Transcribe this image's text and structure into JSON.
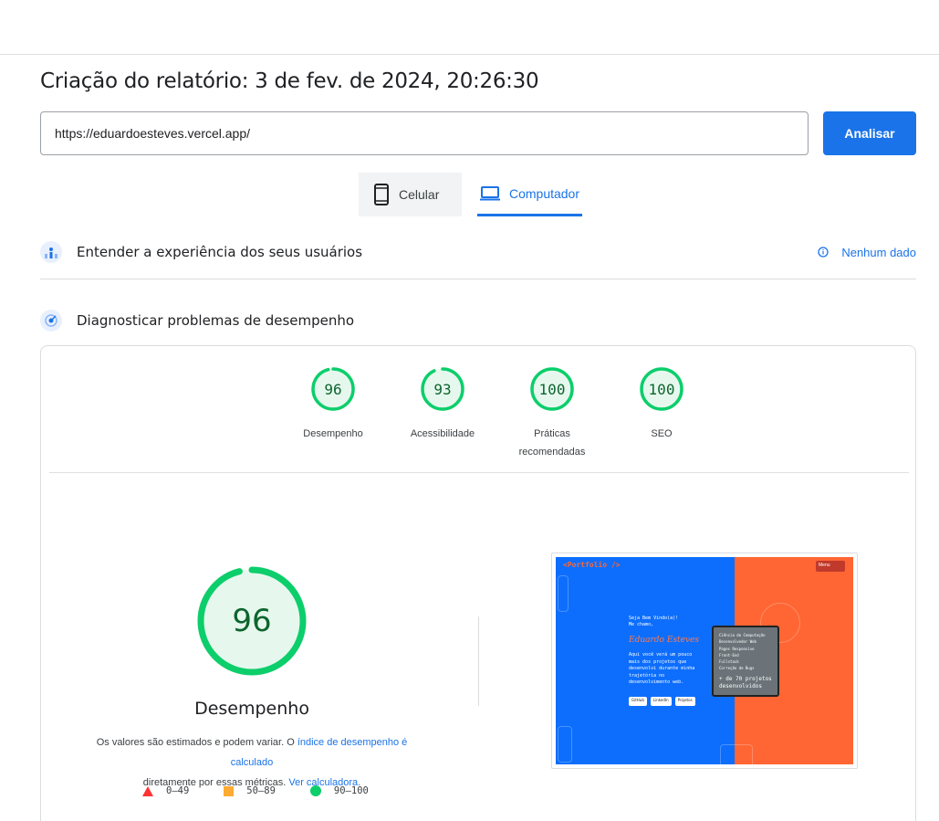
{
  "report": {
    "title": "Criação do relatório: 3 de fev. de 2024, 20:26:30"
  },
  "url_form": {
    "value": "https://eduardoesteves.vercel.app/",
    "analyze_label": "Analisar"
  },
  "device_tabs": [
    {
      "label": "Celular",
      "icon": "smartphone-icon",
      "selected": false
    },
    {
      "label": "Computador",
      "icon": "laptop-icon",
      "selected": true
    }
  ],
  "ux_section": {
    "label": "Entender a experiência dos seus usuários",
    "status": "Nenhum dado"
  },
  "diag_section": {
    "label": "Diagnosticar problemas de desempenho"
  },
  "category_scores": [
    {
      "label": "Desempenho",
      "score": "96",
      "value": 96
    },
    {
      "label": "Acessibilidade",
      "score": "93",
      "value": 93
    },
    {
      "label": "Práticas\nrecomendadas",
      "label_line1": "Práticas",
      "label_line2": "recomendadas",
      "score": "100",
      "value": 100
    },
    {
      "label": "SEO",
      "score": "100",
      "value": 100
    }
  ],
  "performance": {
    "score": "96",
    "value": 96,
    "label": "Desempenho",
    "disclaimer_text1": "Os valores são estimados e podem variar. O ",
    "disclaimer_link1": "índice de desempenho é calculado",
    "disclaimer_text2": "diretamente por essas métricas. ",
    "disclaimer_link2": "Ver calculadora."
  },
  "legend": [
    {
      "range": "0–49",
      "shape": "triangle",
      "color": "#ff3333"
    },
    {
      "range": "50–89",
      "shape": "square",
      "color": "#ffaa33"
    },
    {
      "range": "90–100",
      "shape": "circle",
      "color": "#0cce6b"
    }
  ],
  "screenshot": {
    "logo": "<Portfolio />",
    "menu": "Menu",
    "greeting": "Seja Bem Vindo(a)!",
    "intro": "Me chamo,",
    "name": "Eduardo Esteves",
    "description": "Aqui você verá um pouco mais dos projetos que desenvolvi durante minha trajetória no desenvolvimento web.",
    "buttons": [
      "GitHub",
      "LinkedIn",
      "Projetos"
    ],
    "panel_items": [
      "Ciência da Computação",
      "Desenvolvedor Web",
      "Pages Responsive",
      "Front-End",
      "Fullstack",
      "Correção de Bugs"
    ],
    "panel_highlight": "+ de 70 projetos desenvolvidos"
  },
  "colors": {
    "accent": "#1a73e8",
    "pass": "#0cce6b",
    "pass_text": "#0d652d",
    "average": "#ffaa33",
    "fail": "#ff3333"
  }
}
